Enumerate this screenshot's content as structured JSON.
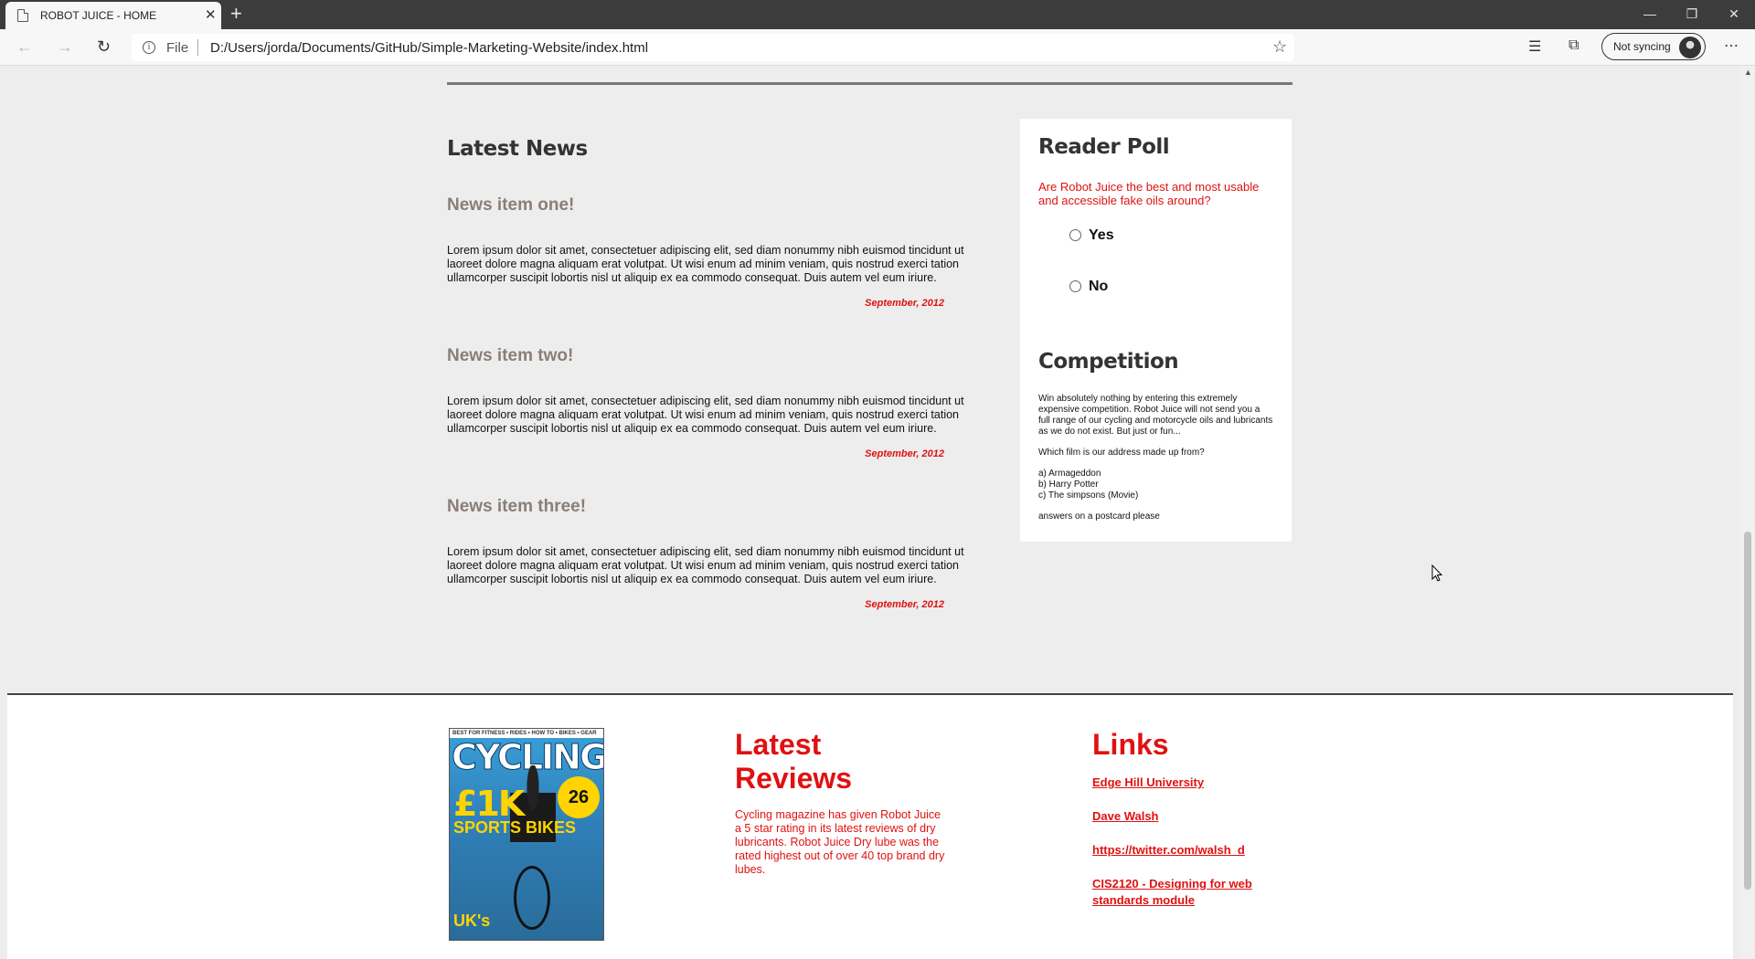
{
  "browser": {
    "tab_title": "ROBOT JUICE - HOME",
    "tab_close": "✕",
    "new_tab": "+",
    "file_label": "File",
    "url": "D:/Users/jorda/Documents/GitHub/Simple-Marketing-Website/index.html",
    "sync_label": "Not syncing",
    "window_controls": {
      "minimize": "—",
      "restore": "❐",
      "close": "✕"
    },
    "icons": {
      "back": "back-arrow-icon",
      "forward": "forward-arrow-icon",
      "refresh": "refresh-icon",
      "info": "info-icon",
      "favorite": "star-icon",
      "favorites": "favorites-list-icon",
      "collections": "collections-icon",
      "more": "more-icon"
    }
  },
  "main": {
    "latest_news_title": "Latest News",
    "news": [
      {
        "heading": "News item one!",
        "body": "Lorem ipsum dolor sit amet, consectetuer adipiscing elit, sed diam nonummy nibh euismod tincidunt ut laoreet dolore magna aliquam erat volutpat. Ut wisi enum ad minim veniam, quis nostrud exerci tation ullamcorper suscipit lobortis nisl ut aliquip ex ea commodo consequat. Duis autem vel eum iriure.",
        "date": "September, 2012"
      },
      {
        "heading": "News item two!",
        "body": "Lorem ipsum dolor sit amet, consectetuer adipiscing elit, sed diam nonummy nibh euismod tincidunt ut laoreet dolore magna aliquam erat volutpat. Ut wisi enum ad minim veniam, quis nostrud exerci tation ullamcorper suscipit lobortis nisl ut aliquip ex ea commodo consequat. Duis autem vel eum iriure.",
        "date": "September, 2012"
      },
      {
        "heading": "News item three!",
        "body": "Lorem ipsum dolor sit amet, consectetuer adipiscing elit, sed diam nonummy nibh euismod tincidunt ut laoreet dolore magna aliquam erat volutpat. Ut wisi enum ad minim veniam, quis nostrud exerci tation ullamcorper suscipit lobortis nisl ut aliquip ex ea commodo consequat. Duis autem vel eum iriure.",
        "date": "September, 2012"
      }
    ]
  },
  "sidebar": {
    "poll_title": "Reader Poll",
    "poll_question": "Are Robot Juice the best and most usable and accessible fake oils around?",
    "poll_options": [
      "Yes",
      "No"
    ],
    "competition_title": "Competition",
    "competition_intro": "Win absolutely nothing by entering this extremely expensive competition. Robot Juice will not send you a full range of our cycling and motorcycle oils and lubricants as we do not exist. But just or fun...",
    "competition_question": "Which film is our address made up from?",
    "competition_answers": [
      "a) Armageddon",
      "b) Harry Potter",
      "c) The simpsons (Movie)"
    ],
    "competition_footer": "answers on a postcard please"
  },
  "footer": {
    "magazine": {
      "masthead": "CYCLING",
      "strap": "BEST FOR FITNESS • RIDES • HOW TO • BIKES • GEAR",
      "headline": "£1K",
      "subheadline": "SPORTS BIKES",
      "badge": "26",
      "bottom": "UK's"
    },
    "reviews_title": "Latest Reviews",
    "reviews_text": "Cycling magazine has given Robot Juice a 5 star rating in its latest reviews of dry lubricants. Robot Juice Dry lube was the rated highest out of over 40 top brand dry lubes.",
    "links_title": "Links",
    "links": [
      "Edge Hill University",
      "Dave Walsh",
      "https://twitter.com/walsh_d",
      "CIS2120 - Designing for web standards module"
    ]
  },
  "colors": {
    "accent_red": "#e01111",
    "news_heading": "#8a7e78",
    "page_bg": "#ededed"
  }
}
